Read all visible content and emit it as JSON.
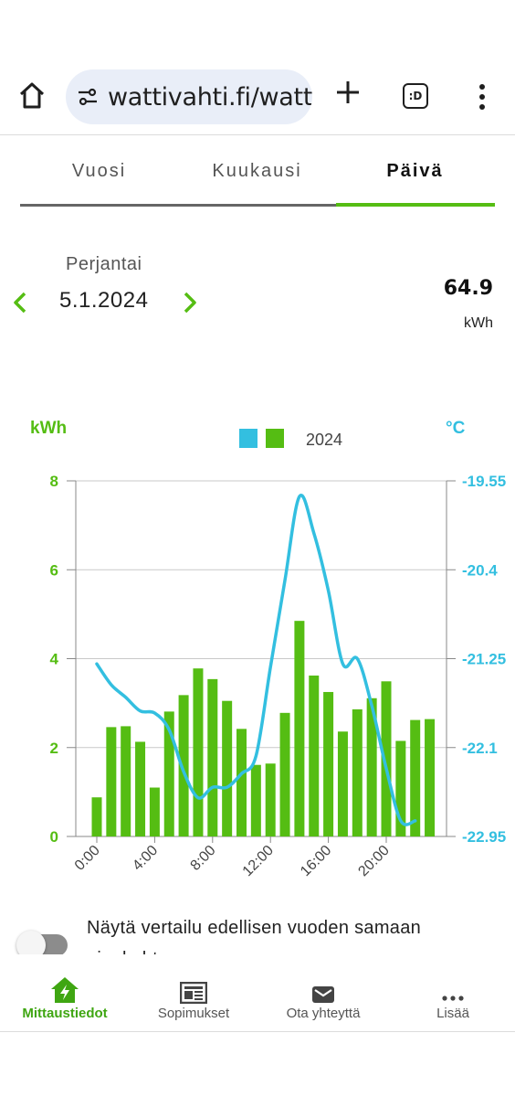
{
  "browser": {
    "url": "wattivahti.fi/watt",
    "tabs_count_label": ":D"
  },
  "period_tabs": [
    {
      "label": "Vuosi",
      "active": false
    },
    {
      "label": "Kuukausi",
      "active": false
    },
    {
      "label": "Päivä",
      "active": true
    }
  ],
  "date_nav": {
    "day_name": "Perjantai",
    "date": "5.1.2024",
    "total_value": "64.9",
    "total_unit": "kWh"
  },
  "colors": {
    "accent_green": "#55bd13",
    "temp_blue": "#33bfe0",
    "legend_blue": "#33bfe0"
  },
  "chart_data": {
    "type": "bar",
    "left_axis_label": "kWh",
    "right_axis_label": "°C",
    "legend_label": "2024",
    "x_tick_labels": [
      "0:00",
      "4:00",
      "8:00",
      "12:00",
      "16:00",
      "20:00"
    ],
    "y_left_ticks": [
      "0",
      "2",
      "4",
      "6",
      "8"
    ],
    "y_right_ticks": [
      "-22.95",
      "-22.1",
      "-21.25",
      "-20.4",
      "-19.55"
    ],
    "ylim_left": [
      0,
      8
    ],
    "ylim_right": [
      -22.95,
      -19.55
    ],
    "hours": [
      0,
      1,
      2,
      3,
      4,
      5,
      6,
      7,
      8,
      9,
      10,
      11,
      12,
      13,
      14,
      15,
      16,
      17,
      18,
      19,
      20,
      21,
      22,
      23
    ],
    "series": [
      {
        "name": "2024",
        "unit": "kWh",
        "values": [
          0.88,
          2.46,
          2.48,
          2.13,
          1.1,
          2.81,
          3.18,
          3.78,
          3.54,
          3.05,
          2.42,
          1.61,
          1.64,
          2.78,
          4.85,
          3.62,
          3.25,
          2.36,
          2.86,
          3.11,
          3.49,
          2.15,
          2.62,
          2.64
        ]
      },
      {
        "unit": "°C",
        "values": [
          -21.3,
          -21.5,
          -21.62,
          -21.75,
          -21.77,
          -21.93,
          -22.33,
          -22.58,
          -22.48,
          -22.48,
          -22.35,
          -22.18,
          -21.33,
          -20.5,
          -19.7,
          -20.05,
          -20.6,
          -21.3,
          -21.25,
          -21.7,
          -22.3,
          -22.8,
          -22.8
        ]
      }
    ],
    "temperature_hours": [
      0,
      1,
      2,
      3,
      4,
      5,
      6,
      7,
      8,
      9,
      10,
      11,
      12,
      13,
      14,
      15,
      16,
      17,
      18,
      19,
      20,
      21,
      22
    ]
  },
  "compare_toggle": {
    "label": "Näytä vertailu edellisen vuoden samaan ajankohtaan",
    "on": false
  },
  "bottom_nav": [
    {
      "label": "Mittaustiedot",
      "icon": "house-bolt-icon",
      "active": true
    },
    {
      "label": "Sopimukset",
      "icon": "newspaper-icon",
      "active": false
    },
    {
      "label": "Ota yhteyttä",
      "icon": "envelope-icon",
      "active": false
    },
    {
      "label": "Lisää",
      "icon": "more-dots-icon",
      "active": false
    }
  ]
}
